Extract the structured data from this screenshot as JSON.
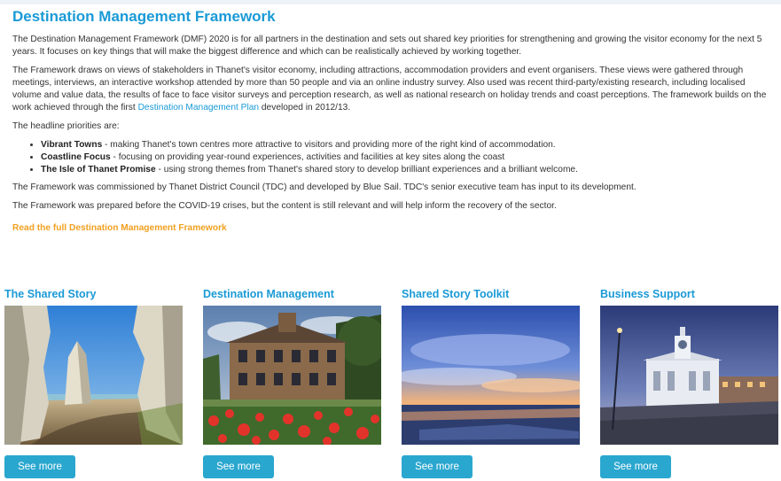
{
  "page": {
    "title": "Destination Management Framework",
    "para1": "The Destination Management Framework (DMF) 2020 is for all partners in the destination and sets out shared key priorities for strengthening and growing the visitor economy for the next 5 years. It focuses on key things that will make the biggest difference and which can be realistically achieved by working together.",
    "para2_before": "The Framework draws on views of stakeholders in Thanet's visitor economy, including attractions, accommodation providers and event organisers. These views were gathered through meetings, interviews, an interactive workshop attended by more than 50 people and via an online industry survey. Also used was recent third-party/existing research, including localised volume and value data, the results of face to face visitor surveys and perception research, as well as national research on holiday trends and coast perceptions. The framework builds on the work achieved through the first ",
    "para2_link": "Destination Management Plan",
    "para2_after": " developed in 2012/13.",
    "priorities_intro": "The headline priorities are:",
    "priorities": [
      {
        "name": "Vibrant Towns",
        "desc": " - making Thanet's town centres more attractive to visitors and providing more of the right kind of accommodation."
      },
      {
        "name": "Coastline Focus",
        "desc": " - focusing on providing year-round experiences, activities and facilities at key sites along the coast"
      },
      {
        "name": "The Isle of Thanet Promise",
        "desc": " - using strong themes from Thanet's shared story to develop brilliant experiences and a brilliant welcome."
      }
    ],
    "para3": "The Framework was commissioned by Thanet District Council (TDC) and developed by Blue Sail. TDC's senior executive team has input to its development.",
    "para4": "The Framework was prepared before the COVID-19 crises, but the content is still relevant and will help inform the recovery of the sector.",
    "read_link": "Read the full Destination Management Framework"
  },
  "cards": [
    {
      "title": "The Shared Story",
      "button": "See more"
    },
    {
      "title": "Destination Management",
      "button": "See more"
    },
    {
      "title": "Shared Story Toolkit",
      "button": "See more"
    },
    {
      "title": "Business Support",
      "button": "See more"
    }
  ],
  "colors": {
    "heading": "#1a9ad6",
    "link_orange": "#f0a020",
    "button": "#2aa7cf"
  }
}
